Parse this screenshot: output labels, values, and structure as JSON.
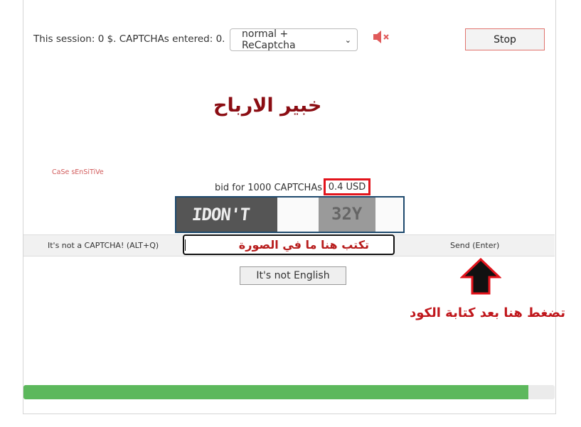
{
  "session": {
    "text": "This session:  0 $. CAPTCHAs entered:  0."
  },
  "mode_select": {
    "value": "normal + ReCaptcha"
  },
  "mute": {
    "icon": "speaker-muted-icon",
    "color": "#e05a5a"
  },
  "stop_button": {
    "label": "Stop"
  },
  "brand": {
    "text": "خبير الارباح",
    "color": "#8b0d13"
  },
  "case_note": {
    "text": "CaSe sEnSiTiVe"
  },
  "bid": {
    "text": "bid for 1000 CAPTCHAs",
    "price": "0.4 USD"
  },
  "captcha": {
    "left_text": "IDON'T",
    "right_text": "32Y"
  },
  "actions": {
    "not_captcha": "It's not a CAPTCHA! (ALT+Q)",
    "send": "Send (Enter)"
  },
  "answer": {
    "text": "تكتب هنا ما في الصورة"
  },
  "not_english_button": {
    "label": "It's not English"
  },
  "hint": {
    "text": "تضغط هنا بعد كتابة الكود"
  },
  "progress": {
    "fraction": 0.95,
    "color": "#5cb85c"
  }
}
